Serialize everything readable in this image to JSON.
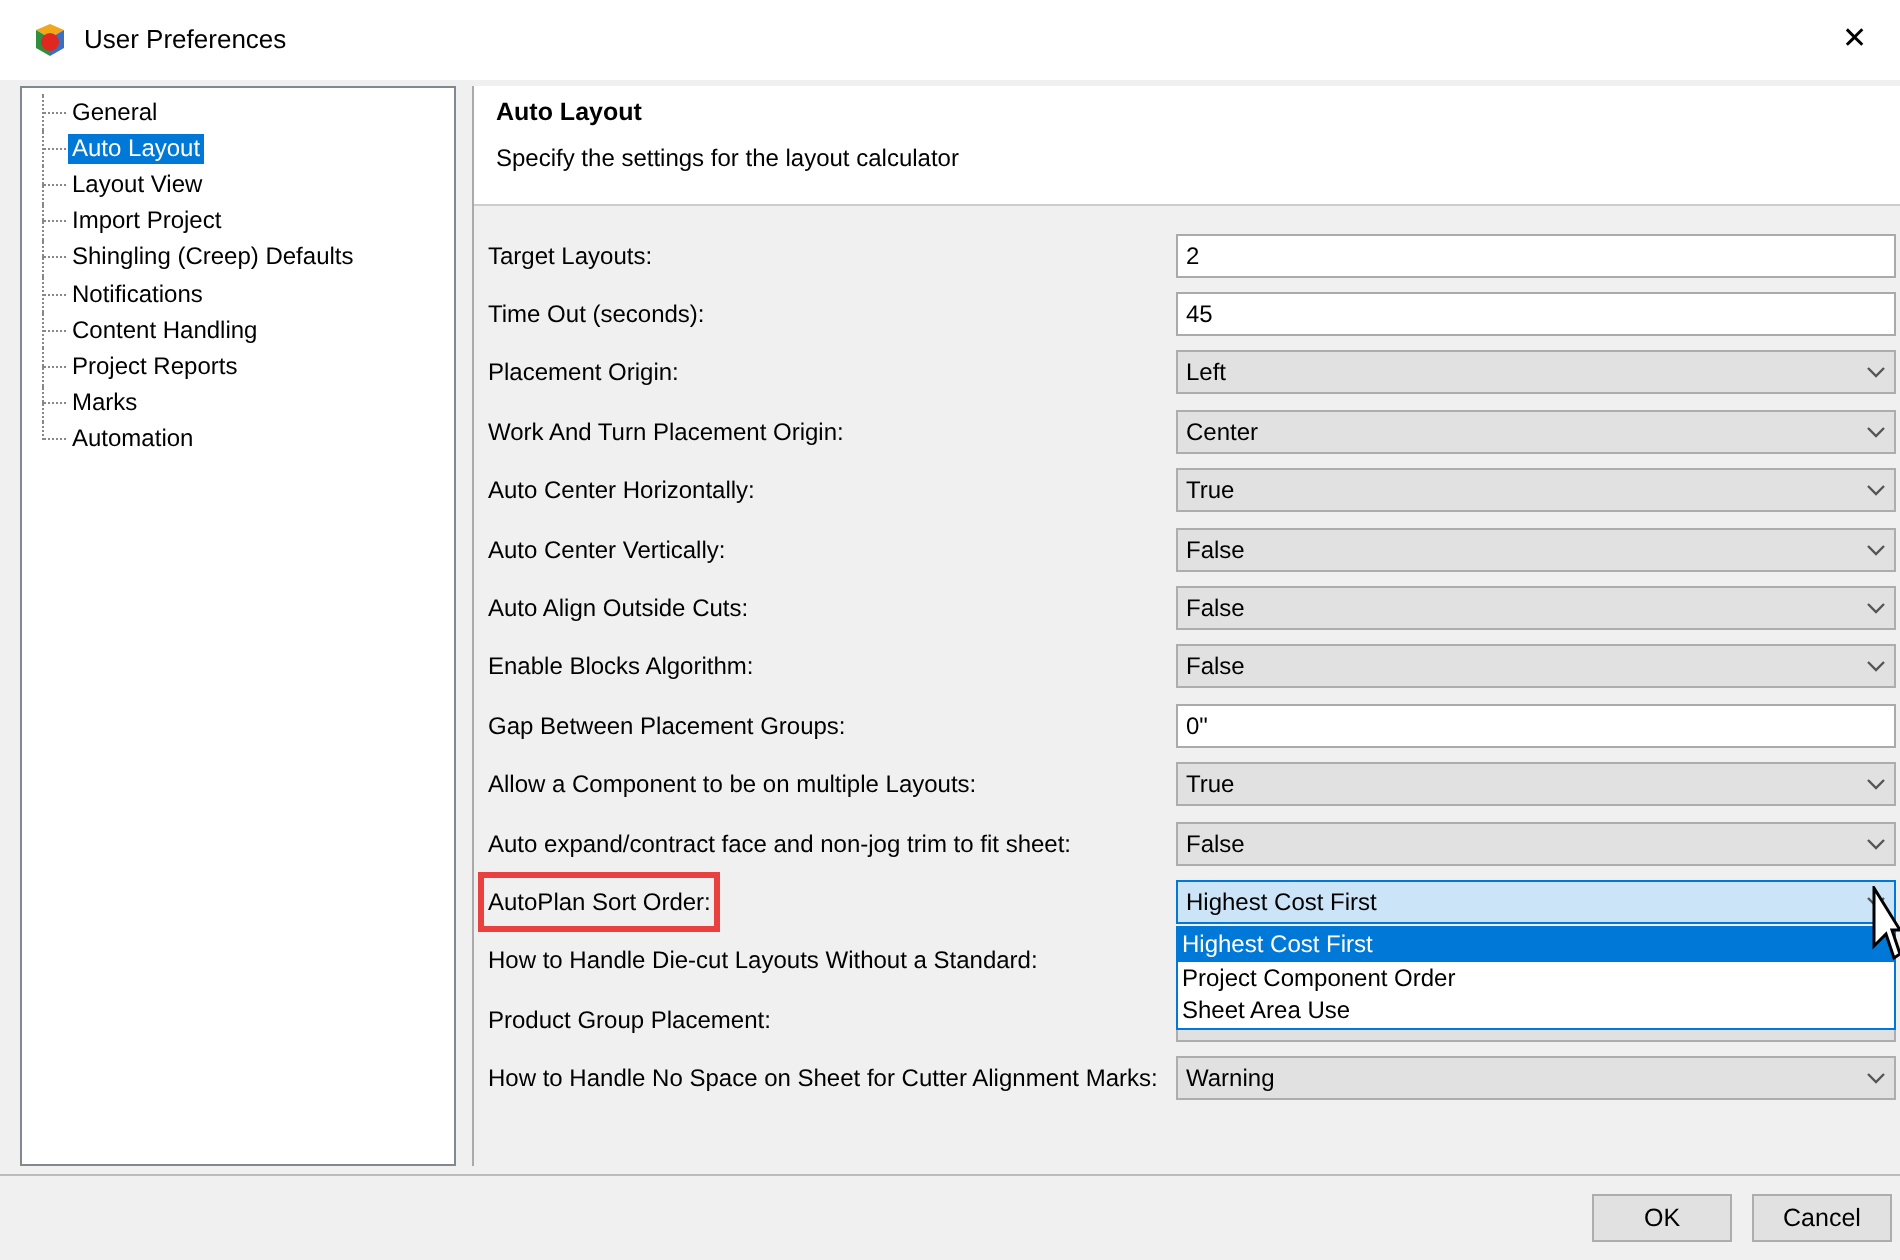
{
  "window": {
    "title": "User Preferences",
    "close": "✕"
  },
  "sidebar": {
    "items": [
      {
        "label": "General",
        "selected": false
      },
      {
        "label": "Auto Layout",
        "selected": true
      },
      {
        "label": "Layout View",
        "selected": false
      },
      {
        "label": "Import Project",
        "selected": false
      },
      {
        "label": "Shingling (Creep) Defaults",
        "selected": false
      },
      {
        "label": "Notifications",
        "selected": false
      },
      {
        "label": "Content Handling",
        "selected": false
      },
      {
        "label": "Project Reports",
        "selected": false
      },
      {
        "label": "Marks",
        "selected": false
      },
      {
        "label": "Automation",
        "selected": false
      }
    ]
  },
  "header": {
    "title": "Auto Layout",
    "description": "Specify the settings for the layout calculator"
  },
  "settings": [
    {
      "label": "Target Layouts:",
      "kind": "text",
      "value": "2"
    },
    {
      "label": "Time Out (seconds):",
      "kind": "text",
      "value": "45"
    },
    {
      "label": "Placement Origin:",
      "kind": "select",
      "value": "Left"
    },
    {
      "label": "Work And Turn Placement Origin:",
      "kind": "select",
      "value": "Center"
    },
    {
      "label": "Auto Center Horizontally:",
      "kind": "select",
      "value": "True"
    },
    {
      "label": "Auto Center Vertically:",
      "kind": "select",
      "value": "False"
    },
    {
      "label": "Auto Align Outside Cuts:",
      "kind": "select",
      "value": "False"
    },
    {
      "label": "Enable Blocks Algorithm:",
      "kind": "select",
      "value": "False"
    },
    {
      "label": "Gap Between Placement Groups:",
      "kind": "text",
      "value": "0\""
    },
    {
      "label": "Allow a Component to be on multiple Layouts:",
      "kind": "select",
      "value": "True"
    },
    {
      "label": "Auto expand/contract face and non-jog trim to fit sheet:",
      "kind": "select",
      "value": "False"
    },
    {
      "label": "AutoPlan Sort Order:",
      "kind": "select",
      "value": "Highest Cost First",
      "highlighted": true,
      "open": true,
      "options": [
        {
          "label": "Highest Cost First",
          "selected": true
        },
        {
          "label": "Project Component Order",
          "selected": false
        },
        {
          "label": "Sheet Area Use",
          "selected": false
        }
      ]
    },
    {
      "label": "How to Handle Die-cut Layouts Without a Standard:",
      "kind": "select"
    },
    {
      "label": "Product Group Placement:",
      "kind": "select"
    },
    {
      "label": "How to Handle No Space on Sheet for Cutter Alignment Marks:",
      "kind": "select",
      "value": "Warning"
    }
  ],
  "buttons": [
    {
      "label": "OK"
    },
    {
      "label": "Cancel"
    }
  ]
}
